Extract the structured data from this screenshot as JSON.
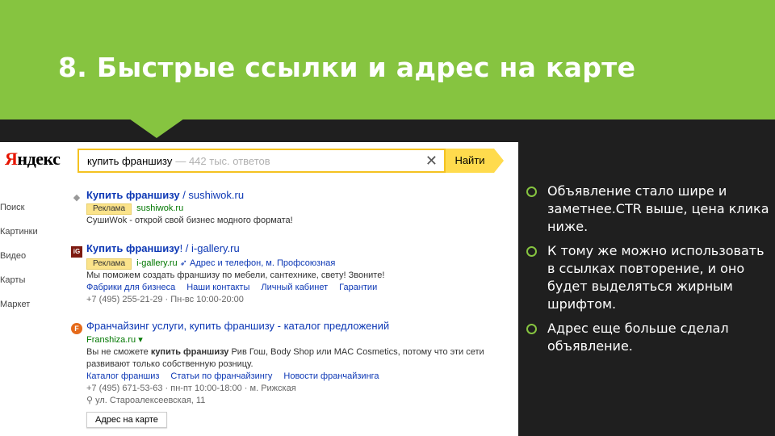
{
  "slide": {
    "title": "8. Быстрые ссылки и адрес на карте",
    "colors": {
      "header": "#86c440",
      "background": "#1f1f1f",
      "bullet": "#86c440"
    },
    "bullets": [
      "Объявление стало шире и заметнее.CTR выше, цена клика ниже.",
      " К тому же можно использовать в ссылках повторение, и оно будет выделяться жирным шрифтом.",
      "Адрес еще больше сделал объявление."
    ]
  },
  "serp": {
    "logo": {
      "first": "Я",
      "rest": "ндекс"
    },
    "search": {
      "query": "купить франшизу",
      "hint": "— 442 тыс. ответов",
      "clear_icon": "✕",
      "button": "Найти"
    },
    "nav": [
      "Поиск",
      "Картинки",
      "Видео",
      "Карты",
      "Маркет"
    ],
    "results": [
      {
        "title_bold": "Купить франшизу",
        "title_rest": " / sushiwok.ru",
        "ad_label": "Реклама",
        "url": "sushiwok.ru",
        "text": "СушиWok - открой свой бизнес модного формата!"
      },
      {
        "title_bold": "Купить франшизу",
        "title_rest": "! / i-gallery.ru",
        "favicon": "iG",
        "ad_label": "Реклама",
        "url": "i-gallery.ru",
        "contacts": "Адрес и телефон, м. Профсоюзная",
        "text": "Мы поможем создать франшизу по мебели, сантехнике, свету! Звоните!",
        "sitelinks": [
          "Фабрики для бизнеса",
          "Наши контакты",
          "Личный кабинет",
          "Гарантии"
        ],
        "phone": "+7 (495) 255-21-29",
        "hours": "Пн-вс 10:00-20:00"
      },
      {
        "title": "Франчайзинг услуги, купить франшизу - каталог предложений",
        "favicon": "F",
        "url": "Franshiza.ru",
        "text_bold": "купить франшизу",
        "text_before": "Вы не сможете ",
        "text_after": " Рив Гош, Body Shop или MAC Cosmetics, потому что эти сети",
        "text_line2": "развивают только собственную розницу.",
        "sitelinks": [
          "Каталог франшиз",
          "Статьи по франчайзингу",
          "Новости франчайзинга"
        ],
        "phone": "+7 (495) 671-53-63",
        "hours": "пн-пт 10:00-18:00",
        "metro": "м. Рижская",
        "address": "ул. Староалексеевская, 11",
        "map_button": "Адрес на карте"
      }
    ]
  }
}
